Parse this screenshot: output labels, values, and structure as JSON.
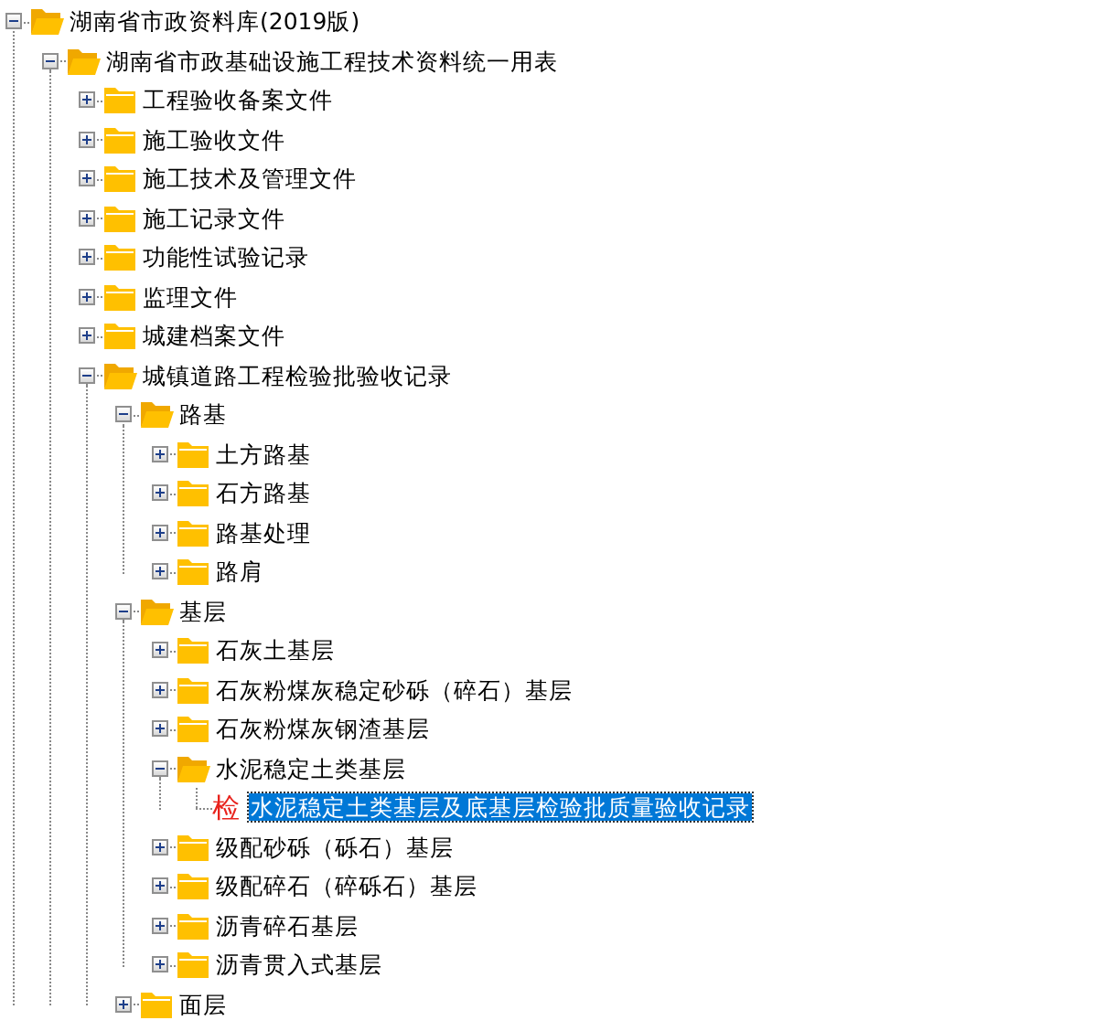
{
  "tree": [
    {
      "text": "湖南省市政资料库(2019版)",
      "kind": "folder",
      "expanded": true,
      "selected": false,
      "children": [
        {
          "text": "湖南省市政基础设施工程技术资料统一用表",
          "kind": "folder",
          "expanded": true,
          "selected": false,
          "children": [
            {
              "text": "工程验收备案文件",
              "kind": "folder",
              "expanded": false,
              "selected": false
            },
            {
              "text": "施工验收文件",
              "kind": "folder",
              "expanded": false,
              "selected": false
            },
            {
              "text": "施工技术及管理文件",
              "kind": "folder",
              "expanded": false,
              "selected": false
            },
            {
              "text": "施工记录文件",
              "kind": "folder",
              "expanded": false,
              "selected": false
            },
            {
              "text": "功能性试验记录",
              "kind": "folder",
              "expanded": false,
              "selected": false
            },
            {
              "text": "监理文件",
              "kind": "folder",
              "expanded": false,
              "selected": false
            },
            {
              "text": "城建档案文件",
              "kind": "folder",
              "expanded": false,
              "selected": false
            },
            {
              "text": "城镇道路工程检验批验收记录",
              "kind": "folder",
              "expanded": true,
              "selected": false,
              "children": [
                {
                  "text": "路基",
                  "kind": "folder",
                  "expanded": true,
                  "selected": false,
                  "children": [
                    {
                      "text": "土方路基",
                      "kind": "folder",
                      "expanded": false,
                      "selected": false
                    },
                    {
                      "text": "石方路基",
                      "kind": "folder",
                      "expanded": false,
                      "selected": false
                    },
                    {
                      "text": "路基处理",
                      "kind": "folder",
                      "expanded": false,
                      "selected": false
                    },
                    {
                      "text": "路肩",
                      "kind": "folder",
                      "expanded": false,
                      "selected": false
                    }
                  ]
                },
                {
                  "text": "基层",
                  "kind": "folder",
                  "expanded": true,
                  "selected": false,
                  "children": [
                    {
                      "text": "石灰土基层",
                      "kind": "folder",
                      "expanded": false,
                      "selected": false
                    },
                    {
                      "text": "石灰粉煤灰稳定砂砾（碎石）基层",
                      "kind": "folder",
                      "expanded": false,
                      "selected": false
                    },
                    {
                      "text": "石灰粉煤灰钢渣基层",
                      "kind": "folder",
                      "expanded": false,
                      "selected": false
                    },
                    {
                      "text": "水泥稳定土类基层",
                      "kind": "folder",
                      "expanded": true,
                      "selected": false,
                      "children": [
                        {
                          "text": "水泥稳定土类基层及底基层检验批质量验收记录",
                          "kind": "document",
                          "icon_char": "检",
                          "selected": true
                        }
                      ]
                    },
                    {
                      "text": "级配砂砾（砾石）基层",
                      "kind": "folder",
                      "expanded": false,
                      "selected": false
                    },
                    {
                      "text": "级配碎石（碎砾石）基层",
                      "kind": "folder",
                      "expanded": false,
                      "selected": false
                    },
                    {
                      "text": "沥青碎石基层",
                      "kind": "folder",
                      "expanded": false,
                      "selected": false
                    },
                    {
                      "text": "沥青贯入式基层",
                      "kind": "folder",
                      "expanded": false,
                      "selected": false
                    }
                  ]
                },
                {
                  "text": "面层",
                  "kind": "folder",
                  "expanded": false,
                  "selected": false
                }
              ]
            }
          ]
        }
      ]
    }
  ]
}
